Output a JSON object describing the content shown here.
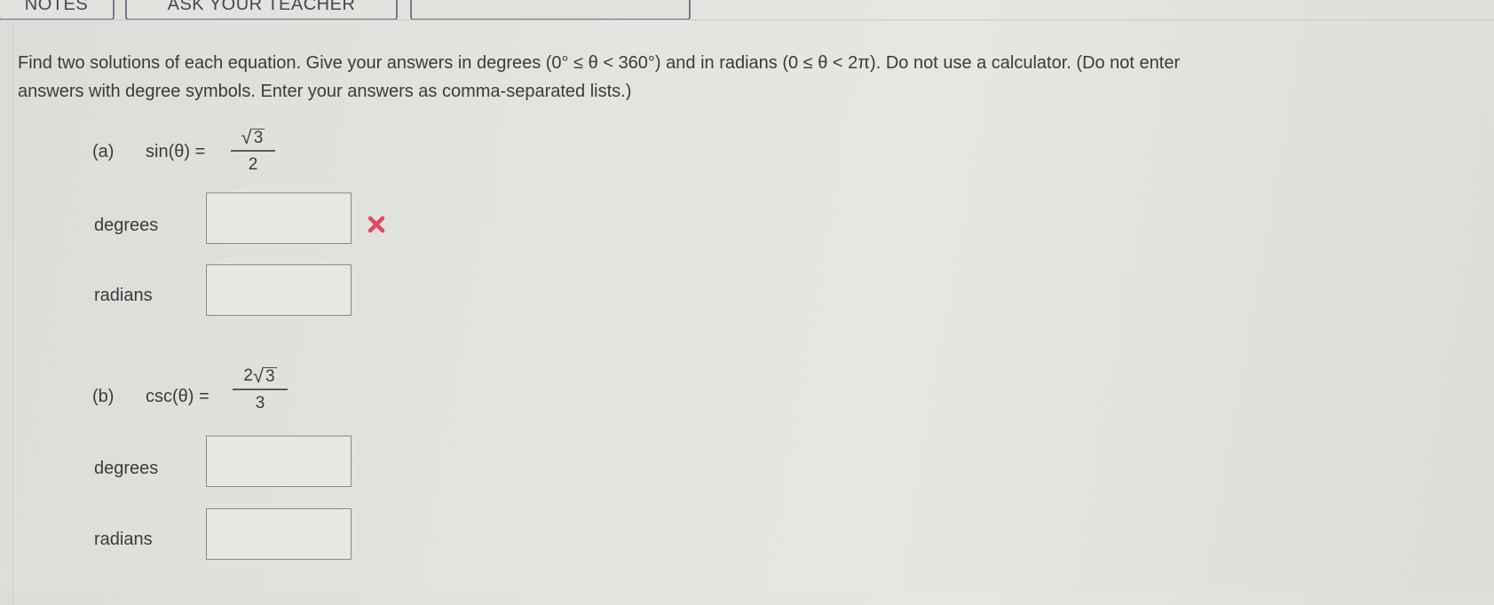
{
  "top_tabs": [
    "NOTES",
    "ASK YOUR TEACHER",
    ""
  ],
  "instructions": {
    "line1": "Find two solutions of each equation. Give your answers in degrees (0° ≤ θ < 360°) and in radians (0 ≤ θ < 2π). Do not use a calculator. (Do not enter",
    "line2": "answers with degree symbols. Enter your answers as comma-separated lists.)"
  },
  "parts": [
    {
      "label": "(a)",
      "lhs": "sin(θ) =",
      "numerator_coef": "",
      "numerator_radicand": "3",
      "denominator": "2",
      "fields": [
        {
          "label": "degrees",
          "value": "",
          "status": "incorrect"
        },
        {
          "label": "radians",
          "value": "",
          "status": "none"
        }
      ]
    },
    {
      "label": "(b)",
      "lhs": "csc(θ) =",
      "numerator_coef": "2",
      "numerator_radicand": "3",
      "denominator": "3",
      "fields": [
        {
          "label": "degrees",
          "value": "",
          "status": "none"
        },
        {
          "label": "radians",
          "value": "",
          "status": "none"
        }
      ]
    }
  ],
  "icons": {
    "incorrect": "x-mark-icon"
  },
  "colors": {
    "incorrect": "#e0485f",
    "tab_border": "#6f7b86"
  }
}
